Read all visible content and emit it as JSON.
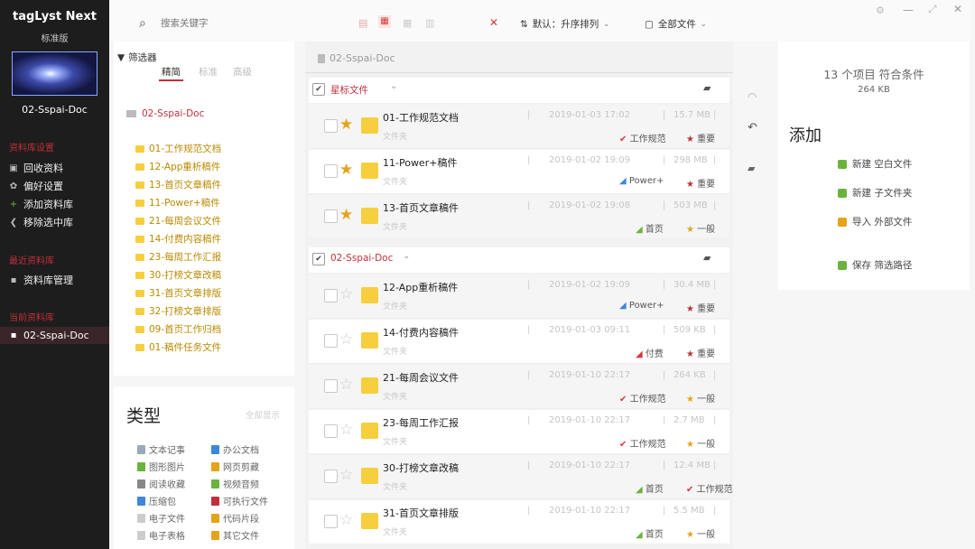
{
  "app": {
    "name": "tagLyst Next",
    "edition": "标准版"
  },
  "sidebar": {
    "library_name": "02-Sspai-Doc",
    "section_library": "资料库设置",
    "library_items": [
      {
        "label": "回收资料",
        "icon": "recycle-icon"
      },
      {
        "label": "偏好设置",
        "icon": "gear-icon"
      },
      {
        "label": "添加资料库",
        "icon": "plus-icon"
      },
      {
        "label": "移除选中库",
        "icon": "back-arrow-icon"
      }
    ],
    "section_recent": "最近资料库",
    "recent_items": [
      {
        "label": "资料库管理",
        "icon": "box-icon"
      }
    ],
    "section_current": "当前资料库",
    "current_items": [
      {
        "label": "02-Sspai-Doc",
        "icon": "box-icon"
      }
    ]
  },
  "toolbar": {
    "search_placeholder": "搜索关键字",
    "sort_label": "默认：升序排列",
    "filter_label": "全部文件"
  },
  "filter_panel": {
    "title": "筛选器",
    "tabs": [
      "精简",
      "标准",
      "高级"
    ],
    "root_folder": "02-Sspai-Doc",
    "folders": [
      "01-工作规范文档",
      "12-App重析稿件",
      "13-首页文章稿件",
      "11-Power+稿件",
      "21-每周会议文件",
      "14-付费内容稿件",
      "23-每周工作汇报",
      "30-打榜文章改稿",
      "31-首页文章排版",
      "32-打榜文章排版",
      "09-首页工作归档",
      "01-稿件任务文件"
    ]
  },
  "type_panel": {
    "title": "类型",
    "action": "全部显示",
    "items": [
      [
        "文本记事",
        "办公文档"
      ],
      [
        "图形图片",
        "网页剪藏"
      ],
      [
        "阅读收藏",
        "视频音频"
      ],
      [
        "压缩包",
        "可执行文件"
      ],
      [
        "电子文件",
        "代码片段"
      ],
      [
        "电子表格",
        "其它文件"
      ]
    ]
  },
  "main": {
    "breadcrumb": "02-Sspai-Doc",
    "groups": [
      {
        "name": "星标文件",
        "files": [
          {
            "name": "01-工作规范文档",
            "sub": "文件夹",
            "starred": true,
            "date": "2019-01-03 17:02",
            "size": "15.7 MB",
            "tags": [
              {
                "label": "工作规范",
                "color": "#d43a3a",
                "icon": "✔"
              },
              {
                "label": "重要",
                "color": "#c0303a",
                "icon": "★"
              }
            ]
          },
          {
            "name": "11-Power+稿件",
            "sub": "文件夹",
            "starred": true,
            "date": "2019-01-02 19:09",
            "size": "298 MB",
            "tags": [
              {
                "label": "Power+",
                "color": "#3e86d8",
                "icon": "◢"
              },
              {
                "label": "重要",
                "color": "#c0303a",
                "icon": "★"
              }
            ]
          },
          {
            "name": "13-首页文章稿件",
            "sub": "文件夹",
            "starred": true,
            "date": "2019-01-02 19:08",
            "size": "503 MB",
            "tags": [
              {
                "label": "首页",
                "color": "#6bb33c",
                "icon": "◢"
              },
              {
                "label": "一般",
                "color": "#e5a31b",
                "icon": "★"
              }
            ]
          }
        ]
      },
      {
        "name": "02-Sspai-Doc",
        "files": [
          {
            "name": "12-App重析稿件",
            "sub": "文件夹",
            "starred": false,
            "date": "2019-01-02 19:09",
            "size": "30.4 MB",
            "tags": [
              {
                "label": "Power+",
                "color": "#3e86d8",
                "icon": "◢"
              },
              {
                "label": "重要",
                "color": "#c0303a",
                "icon": "★"
              }
            ]
          },
          {
            "name": "14-付费内容稿件",
            "sub": "文件夹",
            "starred": false,
            "date": "2019-01-03 09:11",
            "size": "509 KB",
            "tags": [
              {
                "label": "付费",
                "color": "#d43a3a",
                "icon": "◢"
              },
              {
                "label": "重要",
                "color": "#c0303a",
                "icon": "★"
              }
            ]
          },
          {
            "name": "21-每周会议文件",
            "sub": "文件夹",
            "starred": false,
            "date": "2019-01-10 22:17",
            "size": "264 KB",
            "tags": [
              {
                "label": "工作规范",
                "color": "#d43a3a",
                "icon": "✔"
              },
              {
                "label": "一般",
                "color": "#e5a31b",
                "icon": "★"
              }
            ]
          },
          {
            "name": "23-每周工作汇报",
            "sub": "文件夹",
            "starred": false,
            "date": "2019-01-10 22:17",
            "size": "2.7 MB",
            "tags": [
              {
                "label": "工作规范",
                "color": "#d43a3a",
                "icon": "✔"
              },
              {
                "label": "一般",
                "color": "#e5a31b",
                "icon": "★"
              }
            ]
          },
          {
            "name": "30-打榜文章改稿",
            "sub": "文件夹",
            "starred": false,
            "date": "2019-01-10 22:17",
            "size": "12.4 MB",
            "tags": [
              {
                "label": "首页",
                "color": "#6bb33c",
                "icon": "◢"
              },
              {
                "label": "工作规范",
                "color": "#d43a3a",
                "icon": "✔"
              }
            ]
          },
          {
            "name": "31-首页文章排版",
            "sub": "文件夹",
            "starred": false,
            "date": "2019-01-10 22:17",
            "size": "5.5 MB",
            "tags": [
              {
                "label": "首页",
                "color": "#6bb33c",
                "icon": "◢"
              },
              {
                "label": "一般",
                "color": "#e5a31b",
                "icon": "★"
              }
            ]
          }
        ]
      }
    ]
  },
  "right_panel": {
    "count_label": "13 个项目 符合条件",
    "size_label": "264 KB",
    "add_title": "添加",
    "actions": [
      {
        "label": "新建 空白文件",
        "color": "#6bb33c"
      },
      {
        "label": "新建 子文件夹",
        "color": "#6bb33c"
      },
      {
        "label": "导入 外部文件",
        "color": "#e5a31b"
      },
      {
        "label": "保存 筛选路径",
        "color": "#6bb33c"
      }
    ]
  },
  "colors": {
    "accent": "#c0303a",
    "sidebar_bg": "#1d1d1d",
    "folder": "#f6cf3e",
    "star": "#e5a31b"
  }
}
